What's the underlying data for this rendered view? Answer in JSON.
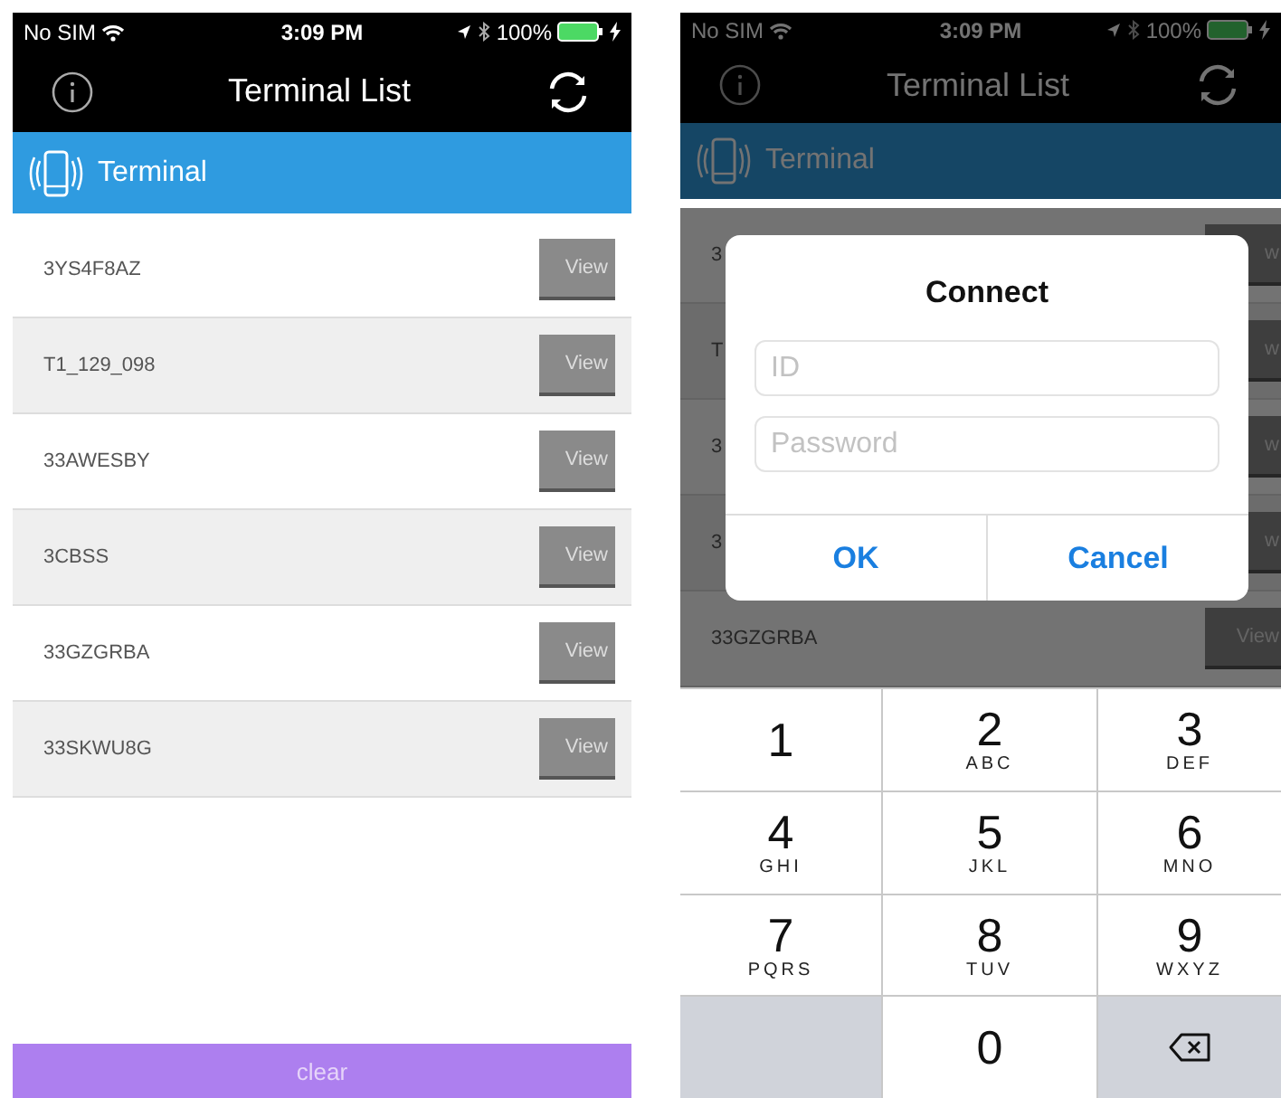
{
  "screens": [
    {
      "dimmed": false,
      "status_bar": {
        "carrier": "No SIM",
        "time": "3:09 PM",
        "battery": "100%"
      },
      "nav_bar": {
        "title": "Terminal List"
      },
      "section_header": {
        "title": "Terminal"
      },
      "terminals": [
        {
          "name": "3YS4F8AZ",
          "action": "View"
        },
        {
          "name": "T1_129_098",
          "action": "View"
        },
        {
          "name": "33AWESBY",
          "action": "View"
        },
        {
          "name": "3CBSS",
          "action": "View"
        },
        {
          "name": "33GZGRBA",
          "action": "View"
        },
        {
          "name": "33SKWU8G",
          "action": "View"
        }
      ],
      "footer_button": "clear"
    },
    {
      "dimmed": true,
      "status_bar": {
        "carrier": "No SIM",
        "time": "3:09 PM",
        "battery": "100%"
      },
      "nav_bar": {
        "title": "Terminal List"
      },
      "section_header": {
        "title": "Terminal"
      },
      "terminals": [
        {
          "name": "3",
          "action": "w"
        },
        {
          "name": "T",
          "action": "w"
        },
        {
          "name": "3",
          "action": "w"
        },
        {
          "name": "3",
          "action": "w"
        },
        {
          "name": "33GZGRBA",
          "action": "View"
        }
      ],
      "dialog": {
        "title": "Connect",
        "fields": [
          {
            "placeholder": "ID"
          },
          {
            "placeholder": "Password"
          }
        ],
        "buttons": [
          "OK",
          "Cancel"
        ]
      },
      "keypad": {
        "keys": [
          {
            "kind": "digit",
            "digit": "1"
          },
          {
            "kind": "digit",
            "digit": "2",
            "letters": "ABC"
          },
          {
            "kind": "digit",
            "digit": "3",
            "letters": "DEF"
          },
          {
            "kind": "digit",
            "digit": "4",
            "letters": "GHI"
          },
          {
            "kind": "digit",
            "digit": "5",
            "letters": "JKL"
          },
          {
            "kind": "digit",
            "digit": "6",
            "letters": "MNO"
          },
          {
            "kind": "digit",
            "digit": "7",
            "letters": "PQRS"
          },
          {
            "kind": "digit",
            "digit": "8",
            "letters": "TUV"
          },
          {
            "kind": "digit",
            "digit": "9",
            "letters": "WXYZ"
          },
          {
            "kind": "blank"
          },
          {
            "kind": "digit",
            "digit": "0"
          },
          {
            "kind": "delete"
          }
        ]
      }
    }
  ]
}
